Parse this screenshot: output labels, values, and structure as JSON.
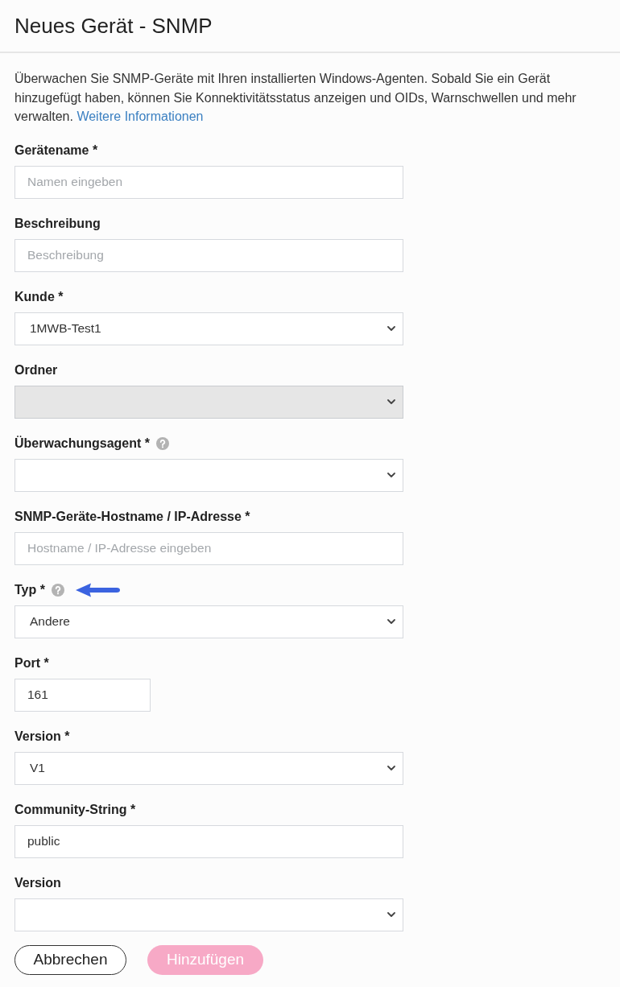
{
  "title": "Neues Gerät - SNMP",
  "intro": {
    "text": "Überwachen Sie SNMP-Geräte mit Ihren installierten Windows-Agenten. Sobald Sie ein Gerät hinzugefügt haben, können Sie Konnektivitätsstatus anzeigen und OIDs, Warnschwellen und mehr verwalten.",
    "link": "Weitere Informationen"
  },
  "fields": [
    {
      "label": "Gerätename *",
      "kind": "text",
      "placeholder": "Namen eingeben",
      "disabled": false,
      "help": false,
      "pointed_at": false
    },
    {
      "label": "Beschreibung",
      "kind": "text",
      "placeholder": "Beschreibung",
      "disabled": false,
      "help": false,
      "pointed_at": false
    },
    {
      "label": "Kunde *",
      "kind": "select",
      "value": "1MWB-Test1",
      "disabled": false,
      "help": false,
      "pointed_at": false
    },
    {
      "label": "Ordner",
      "kind": "select",
      "disabled": true,
      "help": false,
      "pointed_at": false
    },
    {
      "label": "Überwachungsagent *",
      "kind": "select",
      "disabled": false,
      "help": true,
      "pointed_at": false
    },
    {
      "label": "SNMP-Geräte-Hostname / IP-Adresse *",
      "kind": "text",
      "placeholder": "Hostname / IP-Adresse eingeben",
      "disabled": false,
      "help": false,
      "pointed_at": false
    },
    {
      "label": "Typ *",
      "kind": "select",
      "value": "Andere",
      "disabled": false,
      "help": true,
      "pointed_at": true
    },
    {
      "label": "Port *",
      "kind": "number",
      "value": "161",
      "disabled": false,
      "help": false,
      "pointed_at": false
    },
    {
      "label": "Version *",
      "kind": "select",
      "value": "V1",
      "disabled": false,
      "help": false,
      "pointed_at": false
    },
    {
      "label": "Community-String *",
      "kind": "text",
      "value": "public",
      "disabled": false,
      "help": false,
      "pointed_at": false
    },
    {
      "label": "Version",
      "kind": "select",
      "disabled": false,
      "help": false,
      "pointed_at": false
    }
  ],
  "buttons": [
    {
      "label": "Abbrechen",
      "kind": "secondary",
      "disabled": false
    },
    {
      "label": "Hinzufügen",
      "kind": "primary",
      "disabled": true
    }
  ]
}
